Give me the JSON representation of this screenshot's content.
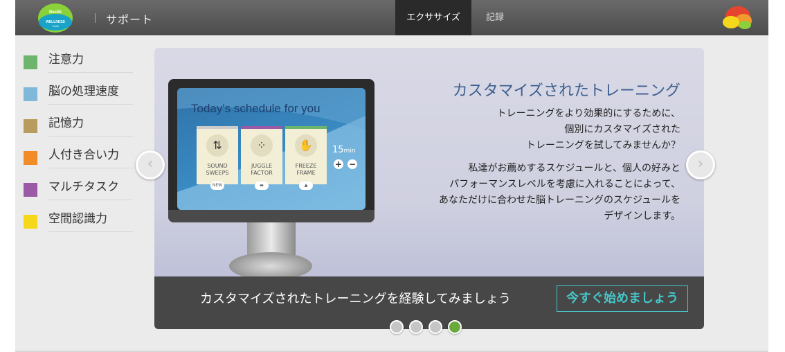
{
  "brand": {
    "logo_line1": "Nestlé",
    "logo_line2": "WELLNESS",
    "logo_line3": "CLUB"
  },
  "header": {
    "support_label": "サポート",
    "tabs": [
      {
        "label": "エクササイズ",
        "active": true
      },
      {
        "label": "記録",
        "active": false
      }
    ]
  },
  "sidebar": {
    "items": [
      {
        "label": "注意力",
        "color": "#6db56d"
      },
      {
        "label": "脳の処理速度",
        "color": "#7fb8d9"
      },
      {
        "label": "記憶力",
        "color": "#b89b5e"
      },
      {
        "label": "人付き合い力",
        "color": "#f28c28"
      },
      {
        "label": "マルチタスク",
        "color": "#9a5aa6"
      },
      {
        "label": "空間認識力",
        "color": "#f5d81c"
      }
    ]
  },
  "slide": {
    "title": "カスタマイズされたトレーニング",
    "para1": [
      "トレーニングをより効果的にするために、",
      "個別にカスタマイズされた",
      "トレーニングを試してみませんか？"
    ],
    "para2": [
      "私達がお薦めするスケジュールと、個人の好みと",
      "パフォーマンスレベルを考慮に入れることによって、",
      "あなただけに合わせた脳トレーニングのスケジュールを",
      "デザインします。"
    ],
    "screen": {
      "heading": "Today's schedule for you",
      "cards": [
        {
          "label_line1": "SOUND",
          "label_line2": "SWEEPS",
          "tag": "NEW",
          "icon": "sound-sweeps-icon",
          "accent": "#cccccc"
        },
        {
          "label_line1": "JUGGLE",
          "label_line2": "FACTOR",
          "tag": "",
          "icon": "juggle-factor-icon",
          "accent": "#9a5aa6"
        },
        {
          "label_line1": "FREEZE FRAME",
          "label_line2": "",
          "tag": "",
          "icon": "freeze-frame-icon",
          "accent": "#6db56d"
        }
      ],
      "minutes": "15",
      "minutes_unit": "min",
      "plus": "+",
      "minus": "−"
    }
  },
  "banner": {
    "text": "カスタマイズされたトレーニングを経験してみましょう",
    "cta": "今すぐ始めましょう"
  },
  "carousel": {
    "prev_arrow": "‹",
    "next_arrow": "›",
    "dot_count": 4,
    "active_dot": 4
  }
}
